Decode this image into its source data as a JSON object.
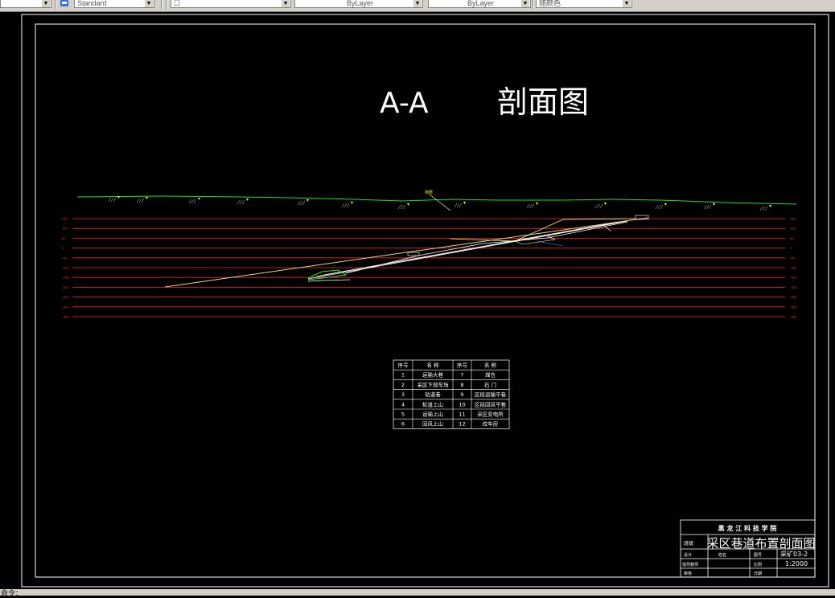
{
  "toolbar": {
    "text_style": "Standard",
    "layer_icon": "layer-icon",
    "linetype": "ByLayer",
    "lineweight": "ByLayer",
    "plot_style": "随颜色"
  },
  "drawing": {
    "title_prefix": "A-A",
    "title_main": "剖面图",
    "elevation_labels": [
      "150",
      "100",
      "50",
      "0",
      "-50",
      "-100",
      "-150",
      "-200",
      "-250",
      "-300",
      "-350"
    ],
    "surface_label": "地表",
    "legend": {
      "headers": [
        "序号",
        "名 称",
        "序号",
        "名 称"
      ],
      "rows": [
        [
          "1",
          "运输大巷",
          "7",
          "煤仓"
        ],
        [
          "2",
          "采区下部车场",
          "8",
          "石 门"
        ],
        [
          "3",
          "轨道巷",
          "9",
          "区段运输平巷"
        ],
        [
          "4",
          "轨道上山",
          "10",
          "区段回风平巷"
        ],
        [
          "5",
          "运输上山",
          "11",
          "采区变电所"
        ],
        [
          "6",
          "回风上山",
          "12",
          "绞车房"
        ]
      ]
    },
    "title_block": {
      "school": "黑 龙 江 科 技 学 院",
      "drawing_name": "采区巷道布置剖面图",
      "row1_left": "班级",
      "row2_c1": "设计",
      "row2_c2": "姓名",
      "row2_c3": "图号",
      "row2_c4": "采矿03-2",
      "row3_c1": "指导教师",
      "row3_c3": "比例",
      "row3_c4": "1:2000",
      "row4_c1": "审核",
      "row4_c3": "日期"
    }
  },
  "statusbar": {
    "text": "命令："
  },
  "colors": {
    "surface": "#22dd22",
    "elevation": "#ff2020",
    "seam": "#f0d080",
    "frame": "#ffffff"
  }
}
